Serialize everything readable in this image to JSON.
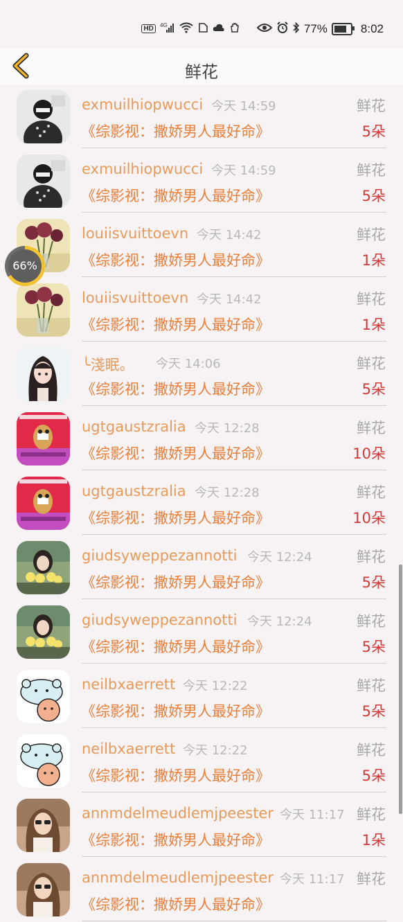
{
  "status": {
    "network": "4G",
    "hd": "HD",
    "battery_percent": "77%",
    "battery_level": 0.77,
    "time": "8:02"
  },
  "header": {
    "title": "鲜花",
    "back_icon": "chevron-left-icon"
  },
  "progress": {
    "label": "66%",
    "value": 0.66
  },
  "entries": [
    {
      "user": "exmuilhiopwucci",
      "time": "今天 14:59",
      "gift": "鲜花",
      "book": "《综影视：撒娇男人最好命》",
      "qty": "5朵",
      "avatar": "masked-person"
    },
    {
      "user": "exmuilhiopwucci",
      "time": "今天 14:59",
      "gift": "鲜花",
      "book": "《综影视：撒娇男人最好命》",
      "qty": "5朵",
      "avatar": "masked-person"
    },
    {
      "user": "louiisvuittoevn",
      "time": "今天 14:42",
      "gift": "鲜花",
      "book": "《综影视：撒娇男人最好命》",
      "qty": "1朵",
      "avatar": "roses"
    },
    {
      "user": "louiisvuittoevn",
      "time": "今天 14:42",
      "gift": "鲜花",
      "book": "《综影视：撒娇男人最好命》",
      "qty": "1朵",
      "avatar": "roses"
    },
    {
      "user": "╰淺眠。",
      "time": "今天 14:06",
      "gift": "鲜花",
      "book": "《综影视：撒娇男人最好命》",
      "qty": "5朵",
      "avatar": "anime-girl"
    },
    {
      "user": "ugtgaustzralia",
      "time": "今天 12:28",
      "gift": "鲜花",
      "book": "《综影视：撒娇男人最好命》",
      "qty": "10朵",
      "avatar": "cartoon-pink"
    },
    {
      "user": "ugtgaustzralia",
      "time": "今天 12:28",
      "gift": "鲜花",
      "book": "《综影视：撒娇男人最好命》",
      "qty": "10朵",
      "avatar": "cartoon-pink"
    },
    {
      "user": "giudsyweppezannotti",
      "time": "今天 12:24",
      "gift": "鲜花",
      "book": "《综影视：撒娇男人最好命》",
      "qty": "5朵",
      "avatar": "girl-flowers"
    },
    {
      "user": "giudsyweppezannotti",
      "time": "今天 12:24",
      "gift": "鲜花",
      "book": "《综影视：撒娇男人最好命》",
      "qty": "5朵",
      "avatar": "girl-flowers"
    },
    {
      "user": "neilbxaerrett",
      "time": "今天 12:22",
      "gift": "鲜花",
      "book": "《综影视：撒娇男人最好命》",
      "qty": "5朵",
      "avatar": "bear-cartoon"
    },
    {
      "user": "neilbxaerrett",
      "time": "今天 12:22",
      "gift": "鲜花",
      "book": "《综影视：撒娇男人最好命》",
      "qty": "5朵",
      "avatar": "bear-cartoon"
    },
    {
      "user": "annmdelmeudlemjpeester",
      "time": "今天 11:17",
      "gift": "鲜花",
      "book": "《综影视：撒娇男人最好命》",
      "qty": "1朵",
      "avatar": "woman-sunglasses"
    },
    {
      "user": "annmdelmeudlemjpeester",
      "time": "今天 11:17",
      "gift": "鲜花",
      "book": "《综影视：撒娇男人最好命》",
      "qty": "",
      "avatar": "woman-sunglasses"
    }
  ]
}
